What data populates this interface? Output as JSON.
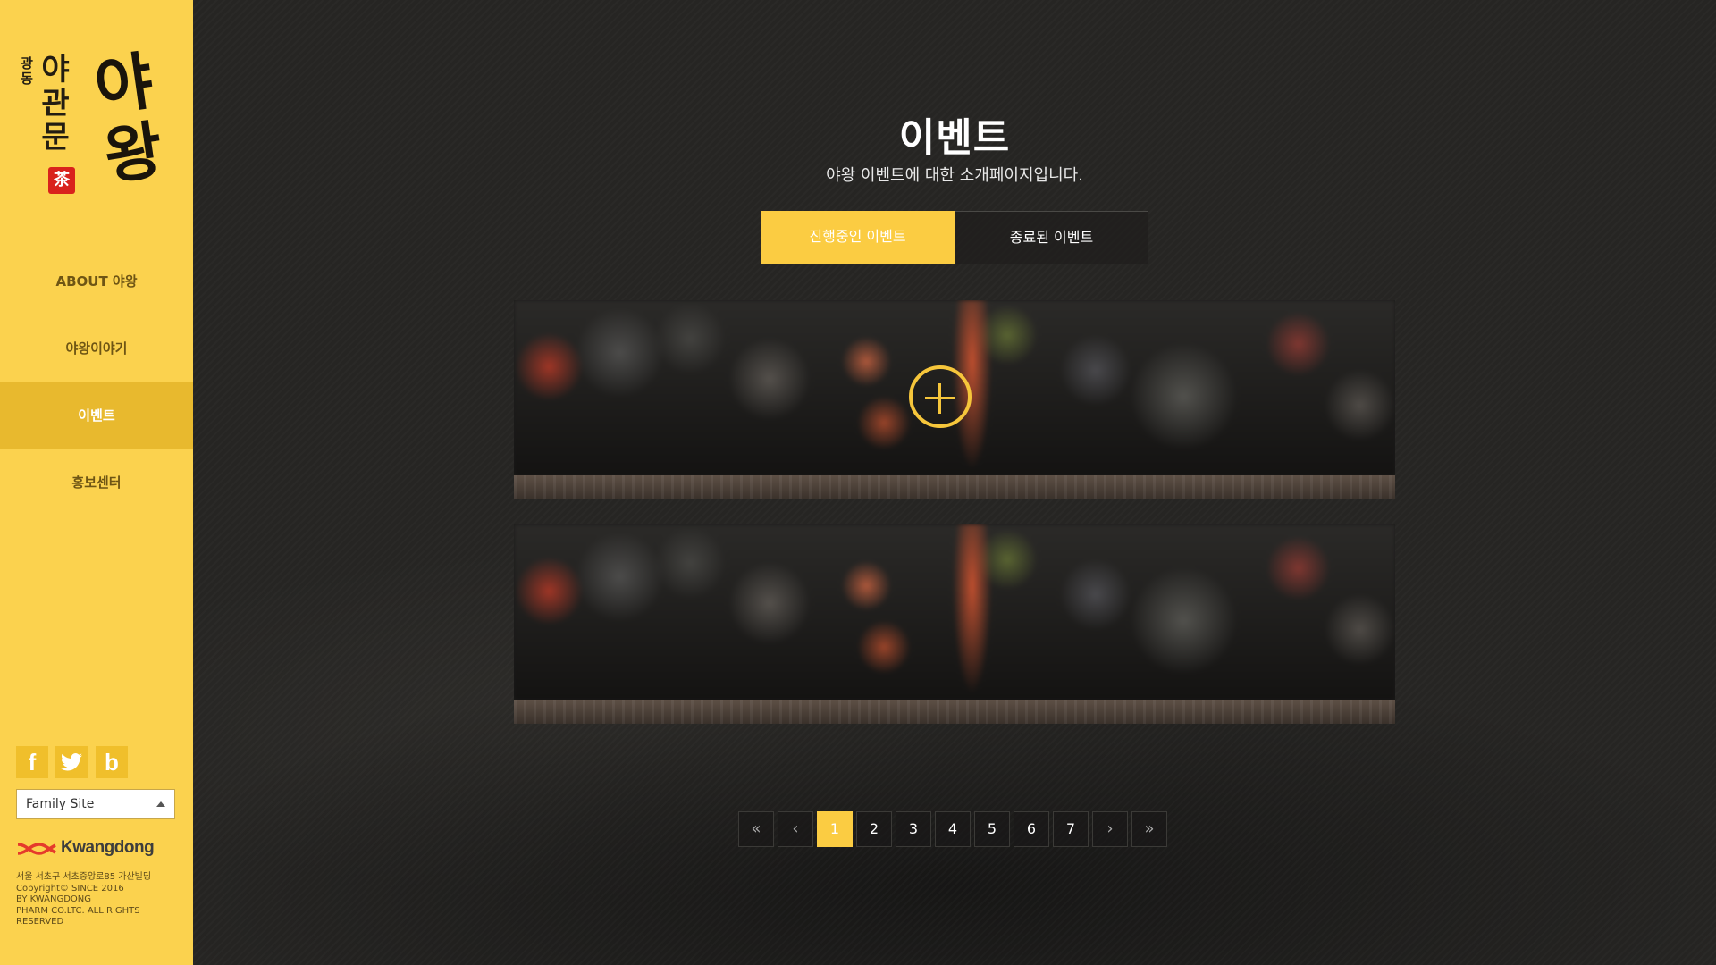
{
  "sidebar": {
    "logo": {
      "small_text": "광동",
      "mid_text": "야관문",
      "big_text": "야왕",
      "seal_text": "茶"
    },
    "nav": [
      {
        "label": "ABOUT 야왕",
        "active": false
      },
      {
        "label": "야왕이야기",
        "active": false
      },
      {
        "label": "이벤트",
        "active": true
      },
      {
        "label": "홍보센터",
        "active": false
      }
    ],
    "socials": [
      {
        "icon": "facebook-icon",
        "glyph": "f"
      },
      {
        "icon": "twitter-icon",
        "glyph": "🐦"
      },
      {
        "icon": "blog-icon",
        "glyph": "b"
      }
    ],
    "family_site": {
      "label": "Family Site"
    },
    "brand": {
      "name": "Kwangdong",
      "color": "#e53a2b"
    },
    "footer": {
      "address": "서울 서초구 서초중앙로85 가산빌딩",
      "copyright": "Copyright© SINCE 2016\nBY KWANGDONG\nPHARM CO.LTC. ALL RIGHTS\nRESERVED"
    }
  },
  "main": {
    "title": "이벤트",
    "subtitle": "야왕 이벤트에 대한 소개페이지입니다.",
    "tabs": [
      {
        "label": "진행중인 이벤트",
        "active": true
      },
      {
        "label": "종료된 이벤트",
        "active": false
      }
    ],
    "pagination": {
      "first": "«",
      "prev": "‹",
      "pages": [
        "1",
        "2",
        "3",
        "4",
        "5",
        "6",
        "7"
      ],
      "current": "1",
      "next": "›",
      "last": "»"
    }
  },
  "colors": {
    "sidebar_bg": "#fbd24e",
    "accent": "#fbcc42",
    "main_bg": "#262523"
  }
}
